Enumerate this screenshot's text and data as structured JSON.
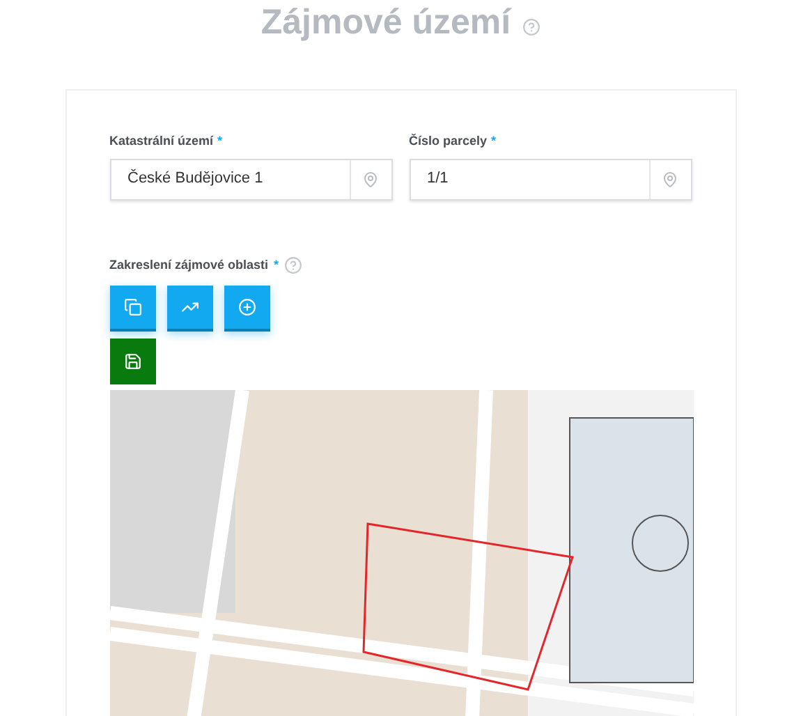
{
  "title": "Zájmové území",
  "fields": [
    {
      "label": "Katastrální území",
      "required_mark": "*",
      "value": "České Budějovice 1"
    },
    {
      "label": "Číslo parcely",
      "required_mark": "*",
      "value": "1/1"
    }
  ],
  "drawing": {
    "label": "Zakreslení zájmové oblasti",
    "required_mark": "*",
    "buttons": [
      {
        "kind": "tool"
      },
      {
        "kind": "tool"
      },
      {
        "kind": "tool"
      },
      {
        "kind": "save"
      }
    ]
  }
}
